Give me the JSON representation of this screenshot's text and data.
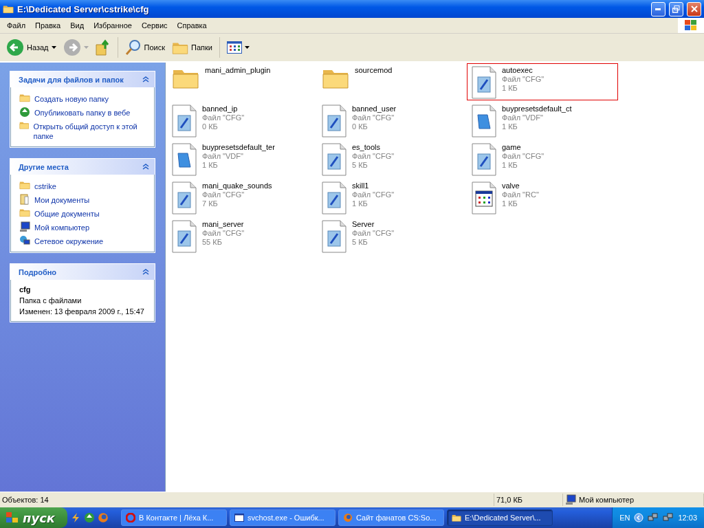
{
  "window": {
    "title": "E:\\Dedicated Server\\cstrike\\cfg"
  },
  "menu": [
    "Файл",
    "Правка",
    "Вид",
    "Избранное",
    "Сервис",
    "Справка"
  ],
  "toolbar": {
    "back": "Назад",
    "search": "Поиск",
    "folders": "Папки"
  },
  "sidebar": [
    {
      "title": "Задачи для файлов и папок",
      "kind": "links",
      "items": [
        {
          "label": "Создать новую папку",
          "kind": "new-folder"
        },
        {
          "label": "Опубликовать папку в вебе",
          "kind": "publish"
        },
        {
          "label": "Открыть общий доступ к этой папке",
          "kind": "share"
        }
      ]
    },
    {
      "title": "Другие места",
      "kind": "links",
      "items": [
        {
          "label": "cstrike",
          "kind": "folder"
        },
        {
          "label": "Мои документы",
          "kind": "documents"
        },
        {
          "label": "Общие документы",
          "kind": "folder"
        },
        {
          "label": "Мой компьютер",
          "kind": "computer"
        },
        {
          "label": "Сетевое окружение",
          "kind": "network"
        }
      ]
    },
    {
      "title": "Подробно",
      "kind": "details",
      "name": "cfg",
      "type": "Папка с файлами",
      "modified": "Изменен: 13 февраля 2009 г., 15:47"
    }
  ],
  "files": [
    {
      "name": "mani_admin_plugin",
      "kind": "folder",
      "highlighted": false
    },
    {
      "name": "sourcemod",
      "kind": "folder",
      "highlighted": false
    },
    {
      "name": "autoexec",
      "kind": "cfg",
      "type": "Файл \"CFG\"",
      "size": "1 КБ",
      "highlighted": true
    },
    {
      "name": "banned_ip",
      "kind": "cfg",
      "type": "Файл \"CFG\"",
      "size": "0 КБ",
      "highlighted": false
    },
    {
      "name": "banned_user",
      "kind": "cfg",
      "type": "Файл \"CFG\"",
      "size": "0 КБ",
      "highlighted": false
    },
    {
      "name": "buypresetsdefault_ct",
      "kind": "vdf",
      "type": "Файл \"VDF\"",
      "size": "1 КБ",
      "highlighted": false
    },
    {
      "name": "buypresetsdefault_ter",
      "kind": "vdf",
      "type": "Файл \"VDF\"",
      "size": "1 КБ",
      "highlighted": false
    },
    {
      "name": "es_tools",
      "kind": "cfg",
      "type": "Файл \"CFG\"",
      "size": "5 КБ",
      "highlighted": false
    },
    {
      "name": "game",
      "kind": "cfg",
      "type": "Файл \"CFG\"",
      "size": "1 КБ",
      "highlighted": false
    },
    {
      "name": "mani_quake_sounds",
      "kind": "cfg",
      "type": "Файл \"CFG\"",
      "size": "7 КБ",
      "highlighted": false
    },
    {
      "name": "skill1",
      "kind": "cfg",
      "type": "Файл \"CFG\"",
      "size": "1 КБ",
      "highlighted": false
    },
    {
      "name": "valve",
      "kind": "rc",
      "type": "Файл \"RC\"",
      "size": "1 КБ",
      "highlighted": false
    },
    {
      "name": "mani_server",
      "kind": "cfg",
      "type": "Файл \"CFG\"",
      "size": "55 КБ",
      "highlighted": false
    },
    {
      "name": "Server",
      "kind": "cfg",
      "type": "Файл \"CFG\"",
      "size": "5 КБ",
      "highlighted": false
    }
  ],
  "status_bar": {
    "objects": "Объектов: 14",
    "size": "71,0 КБ",
    "location": "Мой компьютер"
  },
  "taskbar": {
    "start": "пуск",
    "buttons": [
      {
        "label": "В Контакте | Лёха К...",
        "kind": "opera",
        "selected": false
      },
      {
        "label": "svchost.exe - Ошибк...",
        "kind": "window",
        "selected": false
      },
      {
        "label": "Сайт фанатов CS:So...",
        "kind": "firefox",
        "selected": false
      },
      {
        "label": "E:\\Dedicated Server\\...",
        "kind": "folder",
        "selected": true
      }
    ],
    "lang": "EN",
    "clock": "12:03"
  }
}
